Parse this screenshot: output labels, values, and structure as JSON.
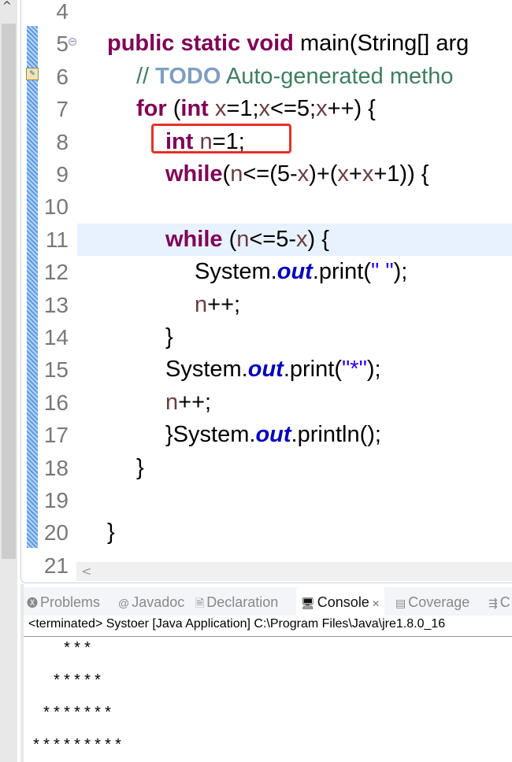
{
  "editor": {
    "lines": [
      {
        "n": "4",
        "t": []
      },
      {
        "n": "5",
        "t": [
          [
            "kw",
            "public static void "
          ],
          [
            "",
            "main(String[] arg"
          ]
        ]
      },
      {
        "n": "6",
        "t": [
          [
            "cm",
            "// "
          ],
          [
            "todo",
            "TODO"
          ],
          [
            "cm",
            " Auto-generated metho"
          ]
        ]
      },
      {
        "n": "7",
        "t": [
          [
            "kw",
            "for"
          ],
          [
            "",
            " ("
          ],
          [
            "kw",
            "int "
          ],
          [
            "var",
            "x"
          ],
          [
            "",
            "=1;"
          ],
          [
            "var",
            "x"
          ],
          [
            "",
            "<=5;"
          ],
          [
            "var",
            "x"
          ],
          [
            "",
            "++) {"
          ]
        ]
      },
      {
        "n": "8",
        "t": [
          [
            "kw",
            "int "
          ],
          [
            "var",
            "n"
          ],
          [
            "",
            "=1;"
          ]
        ]
      },
      {
        "n": "9",
        "t": [
          [
            "kw",
            "while"
          ],
          [
            "",
            "("
          ],
          [
            "var",
            "n"
          ],
          [
            "",
            "<=(5-"
          ],
          [
            "var",
            "x"
          ],
          [
            "",
            ")+("
          ],
          [
            "var",
            "x"
          ],
          [
            "",
            "+"
          ],
          [
            "var",
            "x"
          ],
          [
            "",
            "+1)) {"
          ]
        ]
      },
      {
        "n": "10",
        "t": []
      },
      {
        "n": "11",
        "t": [
          [
            "kw",
            "while"
          ],
          [
            "",
            " ("
          ],
          [
            "var",
            "n"
          ],
          [
            "",
            "<=5-"
          ],
          [
            "var",
            "x"
          ],
          [
            "",
            ") {"
          ]
        ]
      },
      {
        "n": "12",
        "t": [
          [
            "",
            "System."
          ],
          [
            "fld",
            "out"
          ],
          [
            "",
            ".print("
          ],
          [
            "str",
            "\" \""
          ],
          [
            "",
            ");"
          ]
        ]
      },
      {
        "n": "13",
        "t": [
          [
            "var",
            "n"
          ],
          [
            "",
            "++;"
          ]
        ]
      },
      {
        "n": "14",
        "t": [
          [
            "",
            "}"
          ]
        ]
      },
      {
        "n": "15",
        "t": [
          [
            "",
            "System."
          ],
          [
            "fld",
            "out"
          ],
          [
            "",
            ".print("
          ],
          [
            "str",
            "\"*\""
          ],
          [
            "",
            ");"
          ]
        ]
      },
      {
        "n": "16",
        "t": [
          [
            "var",
            "n"
          ],
          [
            "",
            "++;"
          ]
        ]
      },
      {
        "n": "17",
        "t": [
          [
            "",
            "}System."
          ],
          [
            "fld",
            "out"
          ],
          [
            "",
            ".println();"
          ]
        ]
      },
      {
        "n": "18",
        "t": [
          [
            "",
            "}"
          ]
        ]
      },
      {
        "n": "19",
        "t": []
      },
      {
        "n": "20",
        "t": [
          [
            "",
            "}"
          ]
        ]
      },
      {
        "n": "21",
        "t": []
      }
    ],
    "indents": [
      0,
      0,
      1,
      1,
      2,
      2,
      0,
      2,
      3,
      3,
      2,
      2,
      2,
      2,
      1,
      0,
      0,
      0
    ],
    "current_line": "11"
  },
  "tabs": [
    {
      "label": "Problems",
      "icon": "problems-icon"
    },
    {
      "label": "Javadoc",
      "icon": "at-icon"
    },
    {
      "label": "Declaration",
      "icon": "declaration-icon"
    },
    {
      "label": "Console",
      "icon": "console-icon",
      "active": true
    },
    {
      "label": "Coverage",
      "icon": "coverage-icon"
    },
    {
      "label": "C",
      "icon": "call-hierarchy-icon"
    }
  ],
  "console": {
    "status": "<terminated> Systoer [Java Application] C:\\Program Files\\Java\\jre1.8.0_16",
    "output": [
      "   ***",
      "  *****",
      " *******",
      "*********"
    ]
  }
}
